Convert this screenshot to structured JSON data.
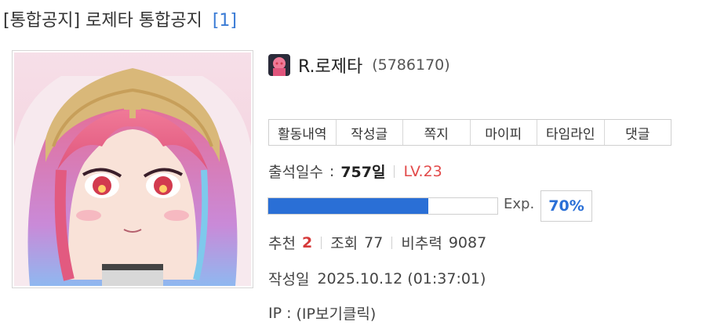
{
  "post": {
    "tag": "[통합공지]",
    "title": "로제타 통합공지",
    "comment_count": "[1]"
  },
  "author": {
    "nickname": "R.로제타",
    "uid": "(5786170)"
  },
  "tabs": [
    "활동내역",
    "작성글",
    "쪽지",
    "마이피",
    "타임라인",
    "댓글"
  ],
  "stats": {
    "attendance_label": "출석일수",
    "attendance_sep": ":",
    "attendance_value": "757일",
    "level": "LV.23",
    "exp_label": "Exp.",
    "exp_percent_text": "70%",
    "exp_fraction": 0.7,
    "recommend_label": "추천",
    "recommend_value": "2",
    "views_label": "조회",
    "views_value": "77",
    "nonrec_label": "비추력",
    "nonrec_value": "9087",
    "date_label": "작성일",
    "date_value": "2025.10.12 (01:37:01)",
    "ip_label": "IP :",
    "ip_value": "(IP보기클릭)"
  },
  "colors": {
    "accent_blue": "#2a6fd6",
    "level_red": "#e24a4a",
    "recommend_red": "#d63a3a"
  }
}
